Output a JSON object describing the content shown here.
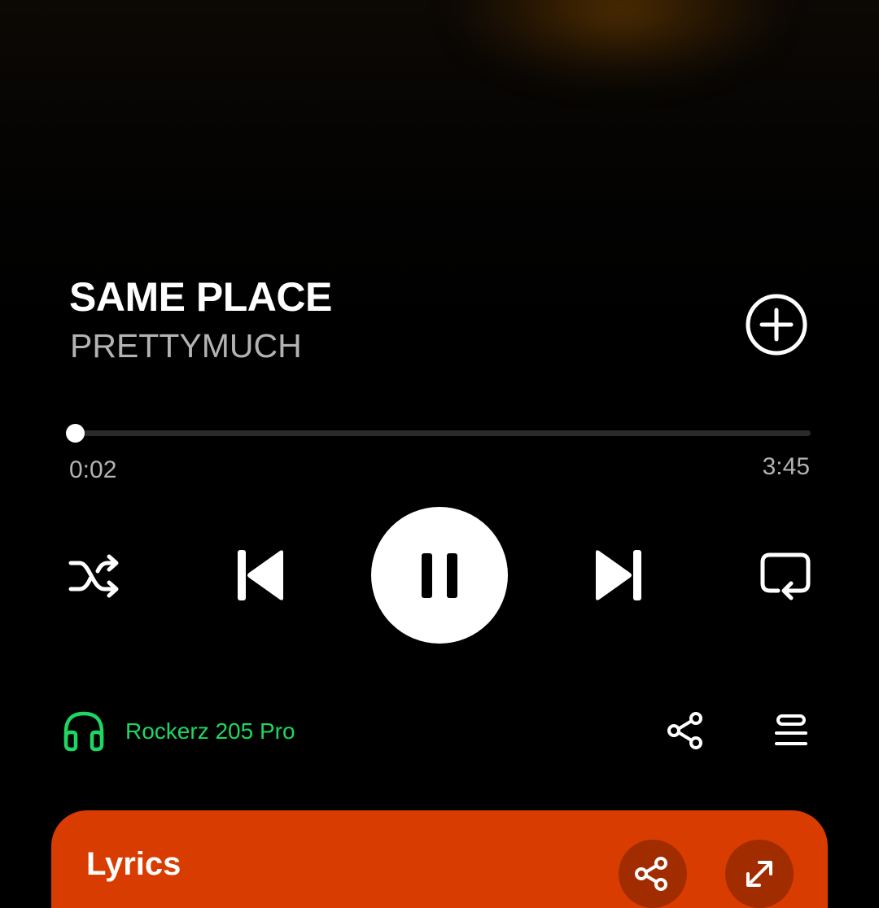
{
  "track": {
    "title": "SAME PLACE",
    "artist": "PRETTYMUCH"
  },
  "playback": {
    "elapsed": "0:02",
    "duration": "3:45",
    "progress_fraction": 0.009,
    "state": "playing"
  },
  "device": {
    "name": "Rockerz 205 Pro",
    "icon": "headphones-icon"
  },
  "lyrics": {
    "title": "Lyrics"
  },
  "colors": {
    "accent_green": "#1ed760",
    "lyrics_bg": "#d93c00",
    "lyrics_button_bg": "#a12c00",
    "secondary_text": "#b3b3b3",
    "background": "#000000"
  },
  "icons": {
    "add": "plus-circle-icon",
    "shuffle": "shuffle-icon",
    "previous": "skip-previous-icon",
    "pause": "pause-icon",
    "next": "skip-next-icon",
    "repeat": "repeat-icon",
    "share": "share-icon",
    "queue": "queue-icon",
    "expand": "expand-icon"
  }
}
